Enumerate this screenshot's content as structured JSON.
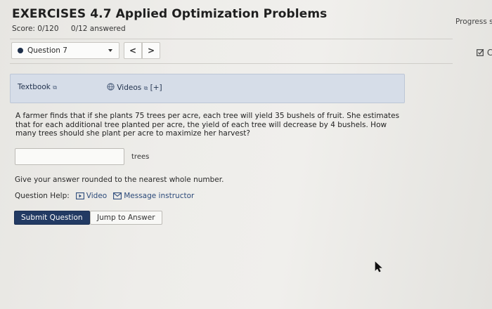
{
  "header": {
    "title": "EXERCISES 4.7 Applied Optimization Problems",
    "score": "Score: 0/120",
    "answered": "0/12 answered",
    "progress_label": "Progress sa"
  },
  "question_nav": {
    "selected": "Question 7",
    "prev_label": "<",
    "next_label": ">",
    "edit_label": "C"
  },
  "resources": {
    "textbook_label": "Textbook",
    "videos_label": "Videos",
    "expand_label": "[+]"
  },
  "problem": {
    "text": "A farmer finds that if she plants 75 trees per acre, each tree will yield 35 bushels of fruit. She estimates that for each additional tree planted per acre, the yield of each tree will decrease by 4 bushels. How many trees should she plant per acre to maximize her harvest?"
  },
  "answer": {
    "value": "",
    "placeholder": "",
    "unit": "trees"
  },
  "instruction": "Give your answer rounded to the nearest whole number.",
  "help": {
    "label": "Question Help:",
    "video_label": "Video",
    "message_label": "Message instructor"
  },
  "actions": {
    "submit_label": "Submit Question",
    "jump_label": "Jump to Answer"
  },
  "colors": {
    "primary_button": "#223a63",
    "resource_bar": "#d6dde8",
    "link": "#2c4a7a"
  }
}
